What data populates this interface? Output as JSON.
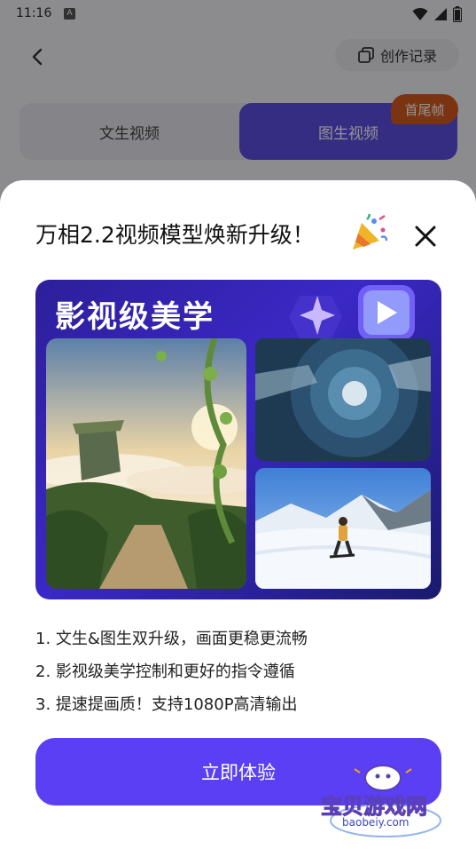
{
  "statusbar": {
    "time": "11:16",
    "app_badge": "A"
  },
  "header": {
    "history_label": "创作记录"
  },
  "tabs": [
    {
      "label": "文生视频",
      "active": false
    },
    {
      "label": "图生视频",
      "active": true
    }
  ],
  "tab_badge": "首尾帧",
  "dialog": {
    "title": "万相2.2视频模型焕新升级！",
    "banner_title": "影视级美学",
    "features": [
      "1. 文生&图生双升级，画面更稳更流畅",
      "2. 影视级美学控制和更好的指令遵循",
      "3. 提速提画质！支持1080P高清输出"
    ],
    "cta_label": "立即体验"
  },
  "watermark": {
    "name": "宝贝游戏网",
    "url": "baobeiy.com"
  },
  "colors": {
    "primary": "#5a3ff5",
    "active_tab": "#5b4fe0",
    "badge": "#d45a1f"
  },
  "icons": [
    "back-arrow-icon",
    "history-copy-icon",
    "close-icon",
    "party-popper-icon",
    "play-icon",
    "sparkle-icon",
    "wifi-icon",
    "signal-icon",
    "battery-icon"
  ]
}
